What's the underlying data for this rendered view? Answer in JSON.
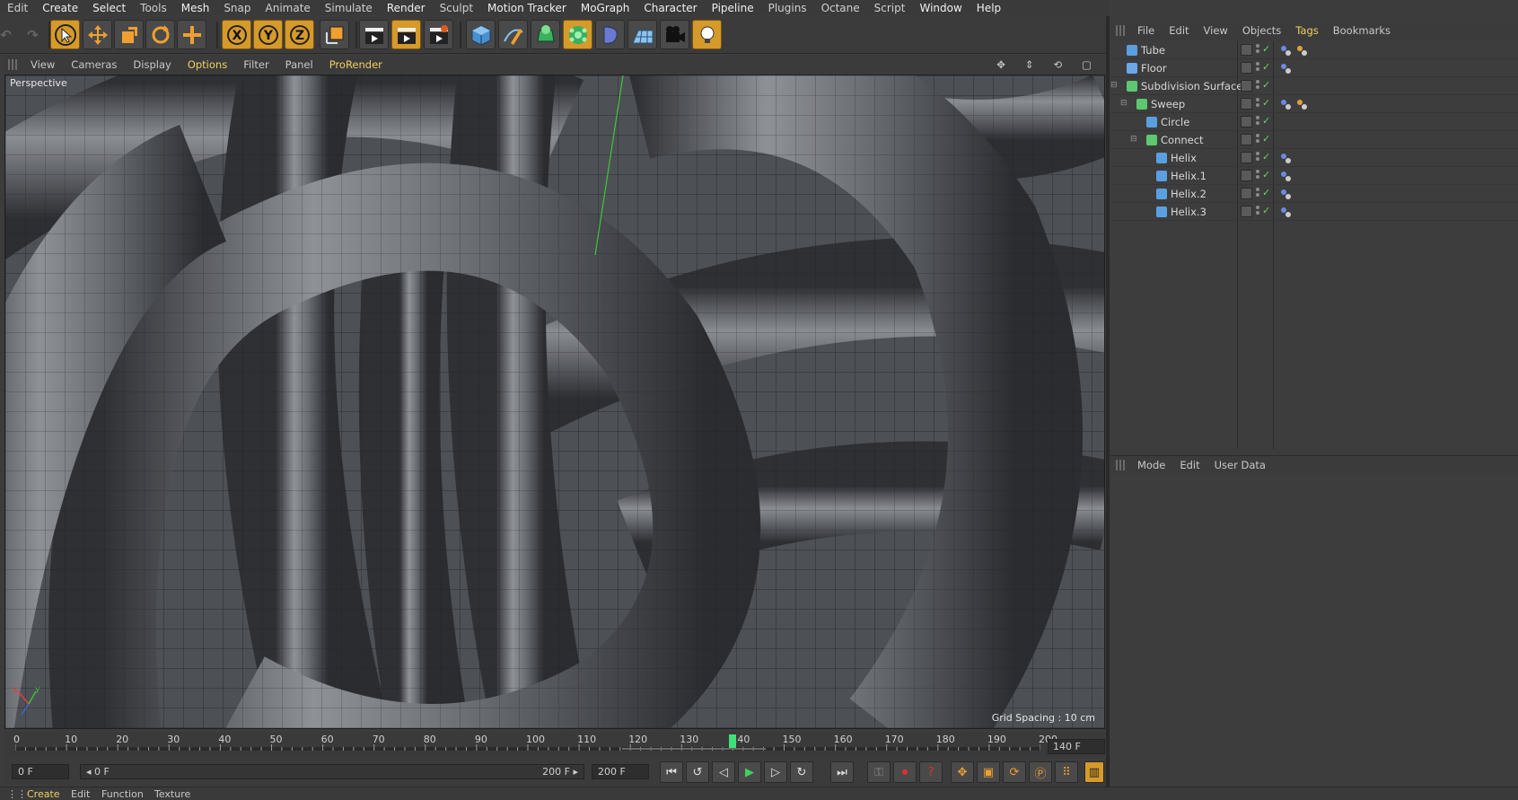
{
  "menubar": [
    "Edit",
    "Create",
    "Select",
    "Tools",
    "Mesh",
    "Snap",
    "Animate",
    "Simulate",
    "Render",
    "Sculpt",
    "Motion Tracker",
    "MoGraph",
    "Character",
    "Pipeline",
    "Plugins",
    "Octane",
    "Script",
    "Window",
    "Help"
  ],
  "toolbar": {
    "axis_x": "X",
    "axis_y": "Y",
    "axis_z": "Z"
  },
  "viewport": {
    "menu": [
      "View",
      "Cameras",
      "Display",
      "Options",
      "Filter",
      "Panel",
      "ProRender"
    ],
    "active_menu": "Options",
    "label": "Perspective",
    "grid_spacing": "Grid Spacing : 10 cm",
    "axis_labels": {
      "x": "X",
      "y": "Y"
    }
  },
  "timeline": {
    "ticks": [
      "0",
      "10",
      "20",
      "30",
      "40",
      "50",
      "60",
      "70",
      "80",
      "90",
      "100",
      "110",
      "120",
      "130",
      "140",
      "150",
      "160",
      "170",
      "180",
      "190",
      "200"
    ],
    "current_frame": 140,
    "current_frame_field": "140 F"
  },
  "transport": {
    "start_field": "0 F",
    "range_start": "◂ 0 F",
    "range_end": "200 F ▸",
    "end_field": "200 F"
  },
  "object_manager": {
    "menu": [
      "File",
      "Edit",
      "View",
      "Objects",
      "Tags",
      "Bookmarks"
    ],
    "active_menu": "Tags",
    "objects": [
      {
        "name": "Tube",
        "depth": 0,
        "icon_color": "#5aa0e0"
      },
      {
        "name": "Floor",
        "depth": 0,
        "icon_color": "#6aa8e8"
      },
      {
        "name": "Subdivision Surface",
        "depth": 0,
        "icon_color": "#5cc870"
      },
      {
        "name": "Sweep",
        "depth": 1,
        "icon_color": "#5cc870"
      },
      {
        "name": "Circle",
        "depth": 2,
        "icon_color": "#5aa0e0"
      },
      {
        "name": "Connect",
        "depth": 2,
        "icon_color": "#5cc870"
      },
      {
        "name": "Helix",
        "depth": 3,
        "icon_color": "#5aa0e0"
      },
      {
        "name": "Helix.1",
        "depth": 3,
        "icon_color": "#5aa0e0"
      },
      {
        "name": "Helix.2",
        "depth": 3,
        "icon_color": "#5aa0e0"
      },
      {
        "name": "Helix.3",
        "depth": 3,
        "icon_color": "#5aa0e0"
      }
    ]
  },
  "attributes": {
    "menu": [
      "Mode",
      "Edit",
      "User Data"
    ]
  },
  "bottom_tabs": [
    "Create",
    "Edit",
    "Function",
    "Texture"
  ],
  "colors": {
    "accent_orange": "#d59a2a",
    "active_text": "#f0d060",
    "check_green": "#6cd06c",
    "playhead": "#3ee07a"
  }
}
